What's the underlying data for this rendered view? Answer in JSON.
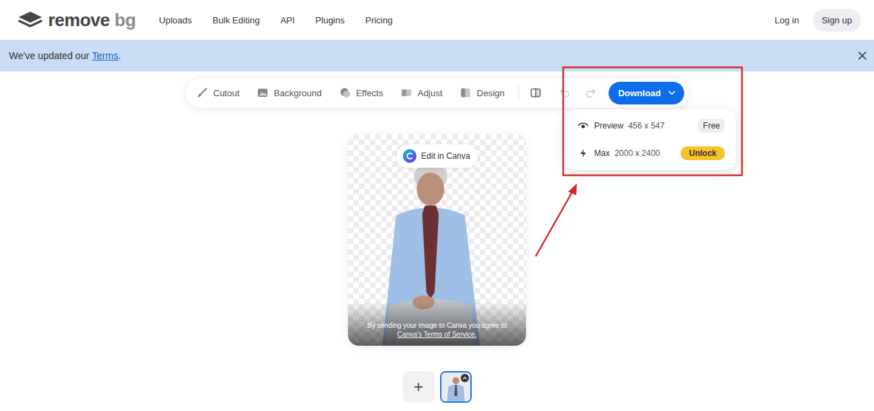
{
  "header": {
    "logo": {
      "word": "remove",
      "suffix": "bg"
    },
    "nav": [
      "Uploads",
      "Bulk Editing",
      "API",
      "Plugins",
      "Pricing"
    ],
    "login": "Log in",
    "signup": "Sign up"
  },
  "banner": {
    "text": "We've updated our",
    "link": "Terms",
    "suffix": "."
  },
  "toolbar": {
    "tools": [
      {
        "label": "Cutout"
      },
      {
        "label": "Background"
      },
      {
        "label": "Effects"
      },
      {
        "label": "Adjust"
      },
      {
        "label": "Design"
      }
    ],
    "undo_disabled": true,
    "redo_disabled": true,
    "download": "Download"
  },
  "download_menu": {
    "open": true,
    "options": [
      {
        "label": "Preview",
        "size": "456 x 547",
        "badge": "Free",
        "locked": false
      },
      {
        "label": "Max",
        "size": "2000 x 2400",
        "badge": "Unlock",
        "locked": true
      }
    ]
  },
  "editor": {
    "canva_button": "Edit in Canva",
    "notice": "By sending your image to Canva you agree to",
    "notice_link": "Canva's Terms of Service."
  },
  "add_button": "+",
  "thumbnails": [
    {
      "selected": true
    }
  ]
}
